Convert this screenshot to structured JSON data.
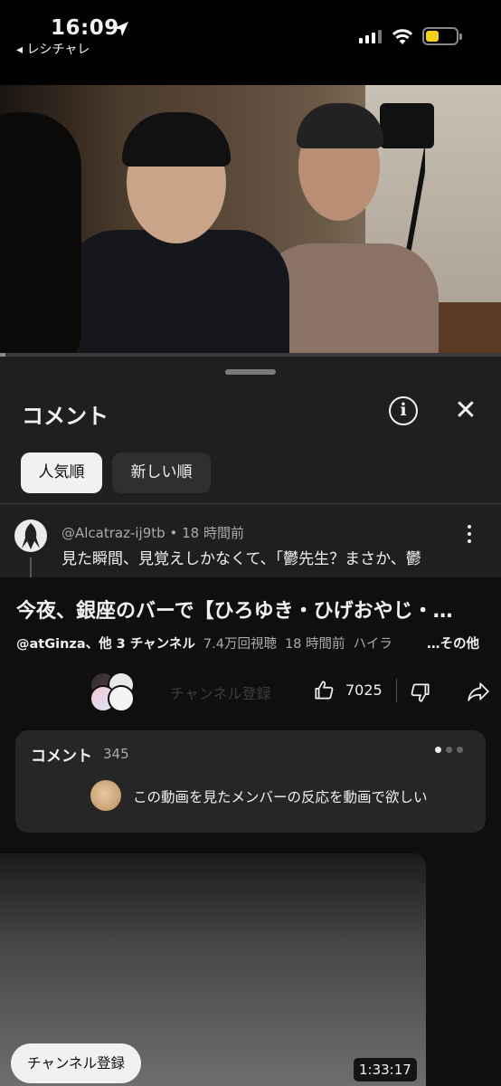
{
  "status_bar": {
    "time": "16:09",
    "back_app": "◂ レシチャレ",
    "battery_color": "#f7d117",
    "icons": [
      "location-arrow-icon",
      "cellular-signal-icon",
      "wifi-icon",
      "battery-icon"
    ]
  },
  "player": {
    "progress": 0.01
  },
  "comments_sheet": {
    "title": "コメント",
    "info_icon": "i",
    "close_icon": "✕",
    "sort_chips": [
      {
        "label": "人気順",
        "selected": true
      },
      {
        "label": "新しい順",
        "selected": false
      }
    ],
    "top_comment": {
      "author": "@Alcatraz-ij9tb",
      "separator": "•",
      "time": "18 時間前",
      "text": "見た瞬間、見覚えしかなくて、「鬱先生？まさか、鬱"
    }
  },
  "video": {
    "title": "今夜、銀座のバーで【ひろゆき・ひげおやじ・…",
    "channel": "@atGinza、他 3 チャンネル",
    "views": "7.4万回視聴",
    "uploaded": "18 時間前",
    "tag": "ハイラ",
    "more_label": "…その他",
    "subscribe_label": "チャンネル登録",
    "likes": "7025"
  },
  "comment_teaser": {
    "label": "コメント",
    "count": "345",
    "text": "この動画を見たメンバーの反応を動画で欲しい"
  },
  "next_video": {
    "subscribe_label": "チャンネル登録",
    "duration": "1:33:17"
  }
}
